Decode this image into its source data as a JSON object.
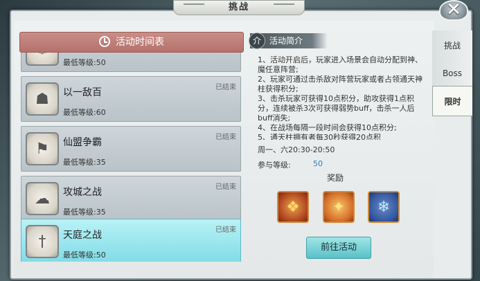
{
  "window": {
    "title": "挑战",
    "close_symbol": "✕"
  },
  "tabs": [
    {
      "label": "挑战",
      "active": false
    },
    {
      "label": "Boss",
      "active": false
    },
    {
      "label": "限时",
      "active": true
    }
  ],
  "schedule": {
    "header": "活动时间表",
    "items": [
      {
        "name": "",
        "level": "最低等级:50",
        "status": "",
        "icon": "partial-scroll-icon"
      },
      {
        "name": "以一敌百",
        "level": "最低等级:60",
        "status": "已结束",
        "icon": "warrior-face-icon"
      },
      {
        "name": "仙盟争霸",
        "level": "最低等级:35",
        "status": "已结束",
        "icon": "banner-flag-icon"
      },
      {
        "name": "攻城之战",
        "level": "最低等级:35",
        "status": "已结束",
        "icon": "castle-cloud-icon"
      },
      {
        "name": "天庭之战",
        "level": "最低等级:50",
        "status": "已结束",
        "icon": "sword-icon",
        "selected": true
      }
    ]
  },
  "intro": {
    "badge": "介",
    "title": "活动简介",
    "lines": [
      "1、活动开启后，玩家进入场景会自动分配到神、魔任意阵营;",
      "2、玩家可通过击杀敌对阵营玩家或者占领通天神柱获得积分;",
      "3、击杀玩家可获得10点积分，助攻获得1点积分，连续被杀3次可获得弱势buff，击杀一人后buff消失;",
      "4、在战场每隔一段时间会获得10点积分;",
      "5、通天柱拥有者每30秒获得20点积"
    ],
    "time": "周一、六20:30-20:50",
    "level_label": "参与等级:",
    "level_value": "50",
    "reward_label": "奖励",
    "rewards": [
      "treasure-bag-icon",
      "star-shard-icon",
      "blue-crystal-icon"
    ],
    "button": "前往活动"
  }
}
